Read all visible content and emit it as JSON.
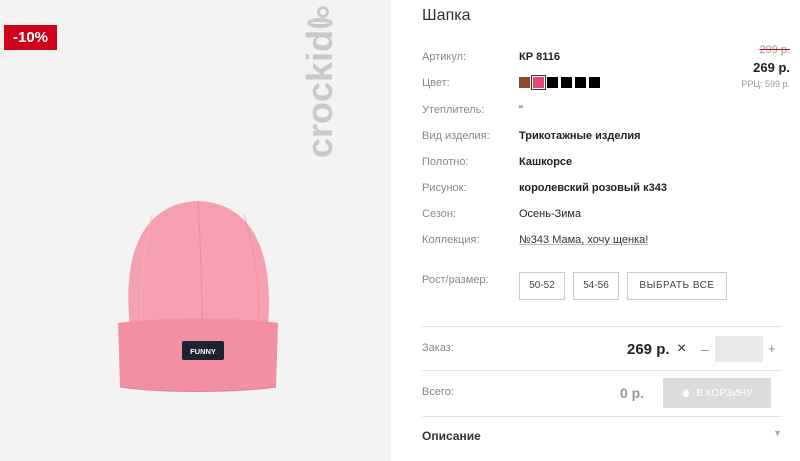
{
  "image": {
    "discount": "-10%",
    "brand": "crockid",
    "hat_tag": "FUNNY",
    "colors": {
      "hat": "#f18fa1",
      "cuff": "#f290a2",
      "brand": "#c9c9c9",
      "background": "#f3f3f3",
      "discount_bg": "#d0021b"
    }
  },
  "product": {
    "title": "Шапка",
    "price_old": "299 р.",
    "price_new": "269 р.",
    "price_rrc": "РРЦ: 599 р.",
    "attributes": [
      {
        "label": "Артикул:",
        "value": "КР 8116",
        "style": "bold"
      },
      {
        "label": "Цвет:",
        "value": "",
        "style": "swatches"
      },
      {
        "label": "Утеплитель:",
        "value": "\"",
        "style": "plain"
      },
      {
        "label": "Вид изделия:",
        "value": "Трикотажные изделия",
        "style": "bold"
      },
      {
        "label": "Полотно:",
        "value": "Кашкорсе",
        "style": "bold"
      },
      {
        "label": "Рисунок:",
        "value": "королевский розовый к343",
        "style": "bold"
      },
      {
        "label": "Сезон:",
        "value": "Осень-Зима",
        "style": "plain"
      },
      {
        "label": "Коллекция:",
        "value": "№343 Мама, хочу щенка!",
        "style": "link"
      }
    ],
    "swatches": [
      {
        "color": "#8b4a2b",
        "selected": false
      },
      {
        "color": "#e8437a",
        "selected": true
      },
      {
        "color": "#000000",
        "selected": false
      },
      {
        "color": "#000000",
        "selected": false
      },
      {
        "color": "#000000",
        "selected": false
      },
      {
        "color": "#000000",
        "selected": false
      },
      {
        "color": "#000000",
        "selected": false
      }
    ],
    "size_label": "Рост/размер:",
    "sizes": [
      "50-52",
      "54-56"
    ],
    "select_all": "ВЫБРАТЬ ВСЕ"
  },
  "order": {
    "label": "Заказ:",
    "price": "269 р.",
    "times": "×",
    "minus": "–",
    "plus": "+",
    "qty": ""
  },
  "total": {
    "label": "Всего:",
    "value": "0 р.",
    "cart_button": "В КОРЗИНУ"
  },
  "description": {
    "label": "Описание"
  }
}
